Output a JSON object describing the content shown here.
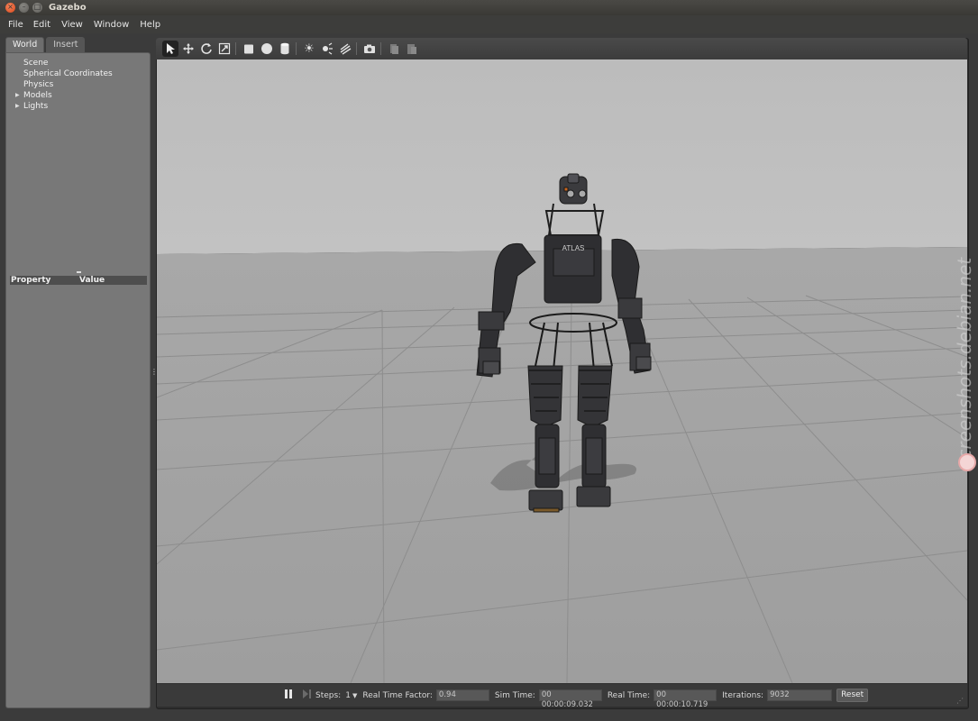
{
  "window": {
    "title": "Gazebo"
  },
  "menu": [
    "File",
    "Edit",
    "View",
    "Window",
    "Help"
  ],
  "left_panel": {
    "tabs": [
      "World",
      "Insert"
    ],
    "tree": [
      {
        "label": "Scene",
        "expandable": false
      },
      {
        "label": "Spherical Coordinates",
        "expandable": false
      },
      {
        "label": "Physics",
        "expandable": false
      },
      {
        "label": "Models",
        "expandable": true
      },
      {
        "label": "Lights",
        "expandable": true
      }
    ],
    "property_header": {
      "property": "Property",
      "value": "Value"
    }
  },
  "toolbar": {
    "icons": [
      "select-arrow-icon",
      "translate-icon",
      "rotate-icon",
      "scale-icon",
      "box-icon",
      "sphere-icon",
      "cylinder-icon",
      "point-light-icon",
      "spot-light-icon",
      "directional-light-icon",
      "screenshot-icon",
      "copy-icon",
      "paste-icon"
    ]
  },
  "scene": {
    "robot_label": "ATLAS",
    "chest_label": "ATLAS"
  },
  "status": {
    "steps_label": "Steps:",
    "steps_value": "1",
    "rtf_label": "Real Time Factor:",
    "rtf_value": "0.94",
    "sim_time_label": "Sim Time:",
    "sim_time_value": "00 00:00:09.032",
    "real_time_label": "Real Time:",
    "real_time_value": "00 00:00:10.719",
    "iterations_label": "Iterations:",
    "iterations_value": "9032",
    "reset_label": "Reset"
  },
  "watermark": "screenshots.debian.net"
}
